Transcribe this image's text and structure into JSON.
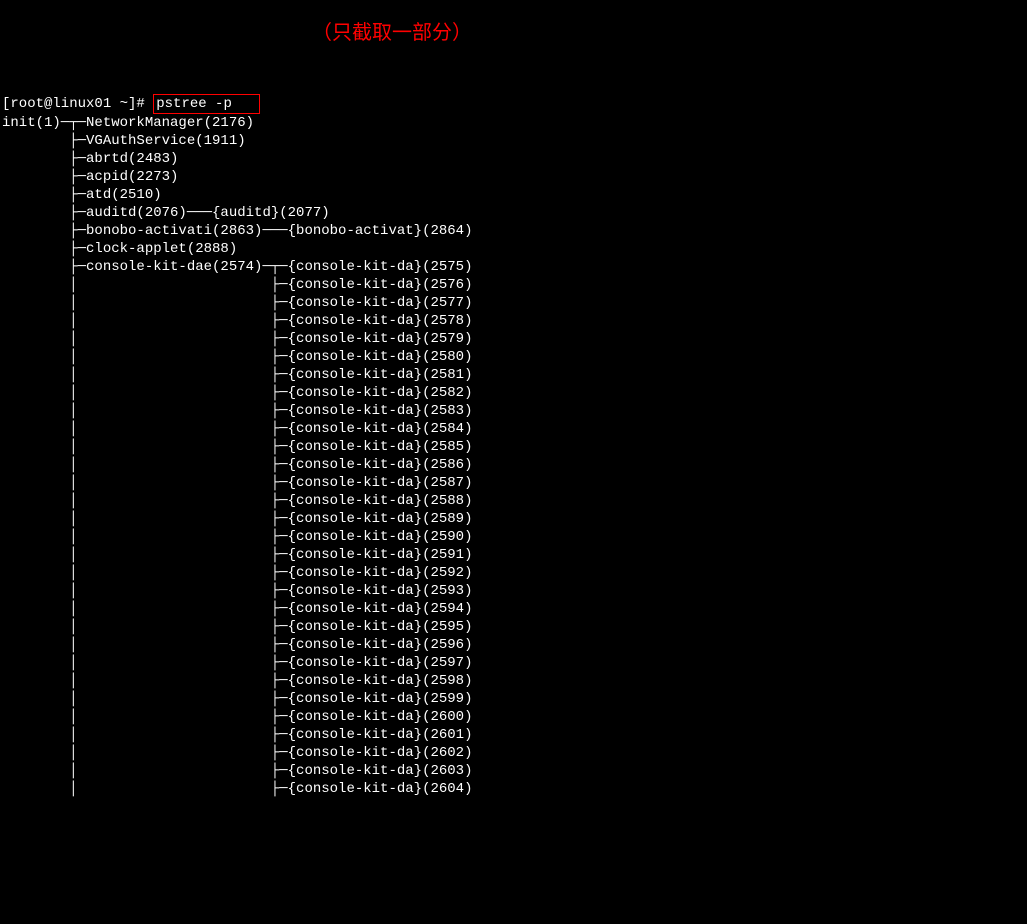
{
  "prompt_prefix": "[root@linux01 ~]# ",
  "command": "pstree -p",
  "annotation": "（只截取一部分）",
  "root": {
    "name": "init",
    "pid": "1"
  },
  "children": [
    {
      "name": "NetworkManager",
      "pid": "2176"
    },
    {
      "name": "VGAuthService",
      "pid": "1911"
    },
    {
      "name": "abrtd",
      "pid": "2483"
    },
    {
      "name": "acpid",
      "pid": "2273"
    },
    {
      "name": "atd",
      "pid": "2510"
    },
    {
      "name": "auditd",
      "pid": "2076",
      "thread": {
        "name": "{auditd}",
        "pid": "2077"
      }
    },
    {
      "name": "bonobo-activati",
      "pid": "2863",
      "thread": {
        "name": "{bonobo-activat}",
        "pid": "2864"
      }
    },
    {
      "name": "clock-applet",
      "pid": "2888"
    },
    {
      "name": "console-kit-dae",
      "pid": "2574",
      "threads": [
        "2575",
        "2576",
        "2577",
        "2578",
        "2579",
        "2580",
        "2581",
        "2582",
        "2583",
        "2584",
        "2585",
        "2586",
        "2587",
        "2588",
        "2589",
        "2590",
        "2591",
        "2592",
        "2593",
        "2594",
        "2595",
        "2596",
        "2597",
        "2598",
        "2599",
        "2600",
        "2601",
        "2602",
        "2603",
        "2604"
      ],
      "thread_name": "{console-kit-da}"
    }
  ]
}
